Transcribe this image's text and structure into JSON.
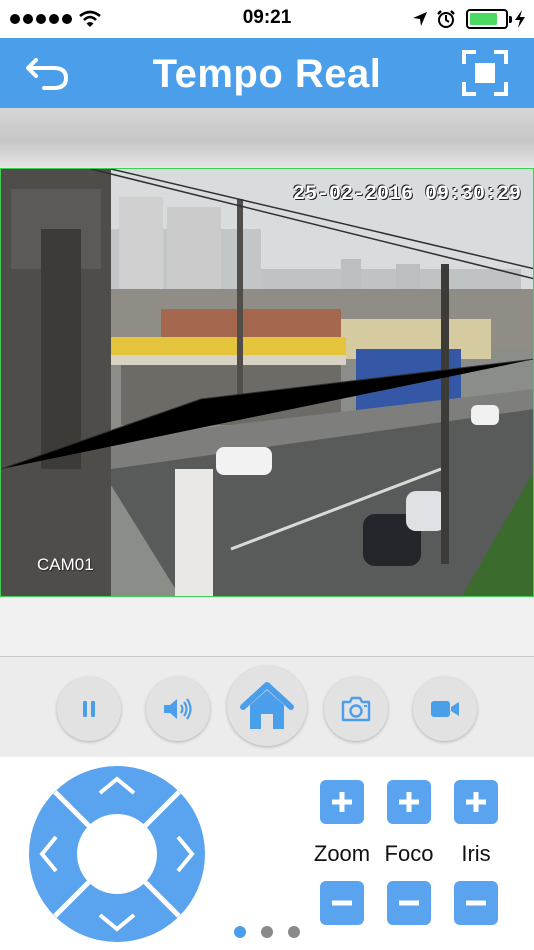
{
  "status_bar": {
    "time": "09:21",
    "battery_level": 0.8
  },
  "nav": {
    "title": "Tempo Real"
  },
  "video": {
    "timestamp": "25-02-2016 09:30:29",
    "camera_label": "CAM01"
  },
  "controls": [
    "pause-icon",
    "speaker-icon",
    "home-icon",
    "camera-icon",
    "video-camera-icon"
  ],
  "lens": {
    "zoom_label": "Zoom",
    "focus_label": "Foco",
    "iris_label": "Iris"
  },
  "pager": {
    "count": 3,
    "active": 0
  },
  "colors": {
    "accent": "#4a9eea",
    "button": "#5aa3ee",
    "video_border": "#3fcf55"
  }
}
